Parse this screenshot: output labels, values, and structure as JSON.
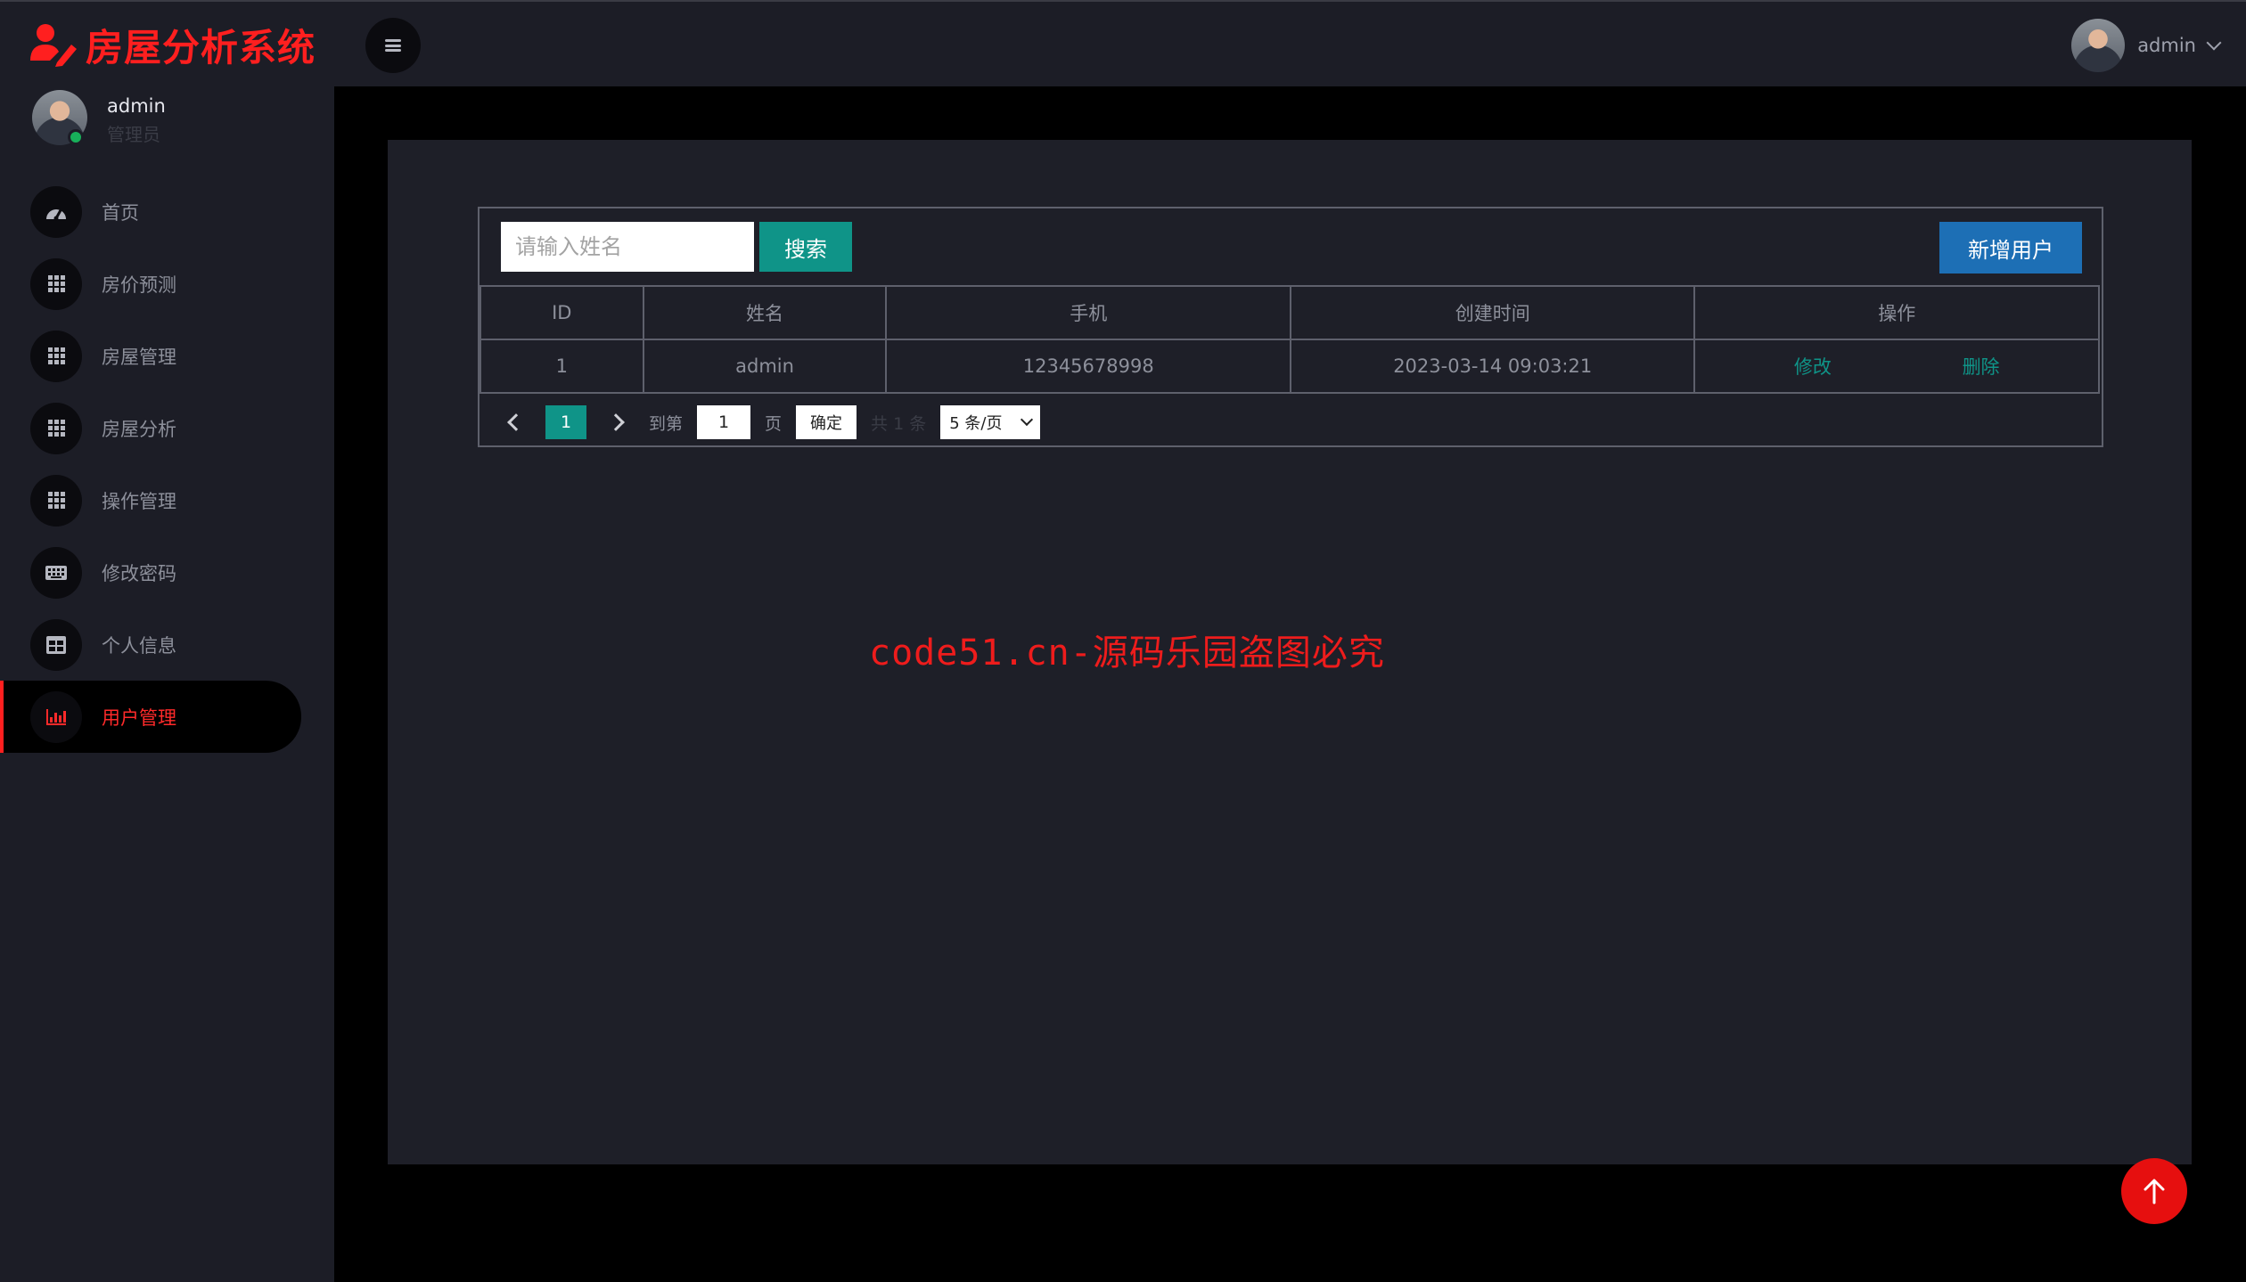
{
  "app": {
    "title": "房屋分析系统"
  },
  "header": {
    "username": "admin"
  },
  "sidebar": {
    "user": {
      "name": "admin",
      "role": "管理员"
    },
    "items": [
      {
        "label": "首页",
        "icon": "dashboard-icon"
      },
      {
        "label": "房价预测",
        "icon": "grid-icon"
      },
      {
        "label": "房屋管理",
        "icon": "grid-icon"
      },
      {
        "label": "房屋分析",
        "icon": "grid-icon"
      },
      {
        "label": "操作管理",
        "icon": "grid-icon"
      },
      {
        "label": "修改密码",
        "icon": "keyboard-icon"
      },
      {
        "label": "个人信息",
        "icon": "table-icon"
      },
      {
        "label": "用户管理",
        "icon": "bar-chart-icon",
        "active": true
      }
    ]
  },
  "toolbar": {
    "search_placeholder": "请输入姓名",
    "search_label": "搜索",
    "add_label": "新增用户"
  },
  "table": {
    "headers": [
      "ID",
      "姓名",
      "手机",
      "创建时间",
      "操作"
    ],
    "rows": [
      {
        "id": "1",
        "name": "admin",
        "phone": "12345678998",
        "created": "2023-03-14 09:03:21",
        "edit": "修改",
        "delete": "删除"
      }
    ]
  },
  "pager": {
    "current_page": "1",
    "goto_prefix": "到第",
    "goto_value": "1",
    "goto_suffix": "页",
    "confirm_label": "确定",
    "total_label": "共 1 条",
    "page_size": "5 条/页"
  },
  "watermark": "code51.cn-源码乐园盗图必究",
  "colors": {
    "brand": "#ff1f1f",
    "primary": "#0f9488",
    "add_button": "#1d6fb5",
    "sidebar_bg": "#1c1d26",
    "panel_bg": "#1e1f28"
  }
}
